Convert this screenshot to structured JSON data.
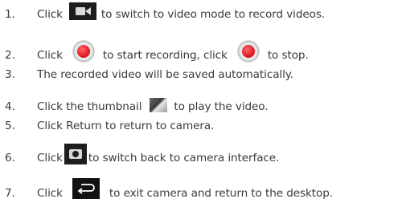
{
  "steps": [
    {
      "num": "1.",
      "pre": "Click",
      "icon": "video-camera-icon",
      "post": "to switch to video mode to record videos."
    },
    {
      "num": "2.",
      "pre": "Click",
      "icon": "record-button-icon",
      "mid": "to start recording, click",
      "icon2": "record-button-icon",
      "post": "to stop."
    },
    {
      "num": "3.",
      "text": "The recorded video will be saved automatically."
    },
    {
      "num": "4.",
      "pre": "Click the thumbnail",
      "icon": "thumbnail-icon",
      "post": "to play the video."
    },
    {
      "num": "5.",
      "text": "Click Return to return to camera."
    },
    {
      "num": "6.",
      "pre": "Click",
      "icon": "camera-icon",
      "post": "to switch back to camera interface."
    },
    {
      "num": "7.",
      "pre": "Click",
      "icon": "back-arrow-icon",
      "post": "to exit camera and return to the desktop."
    }
  ],
  "colors": {
    "text": "#3a3a3a",
    "record_red": "#d9101a",
    "icon_dark": "#1c1c1c"
  }
}
